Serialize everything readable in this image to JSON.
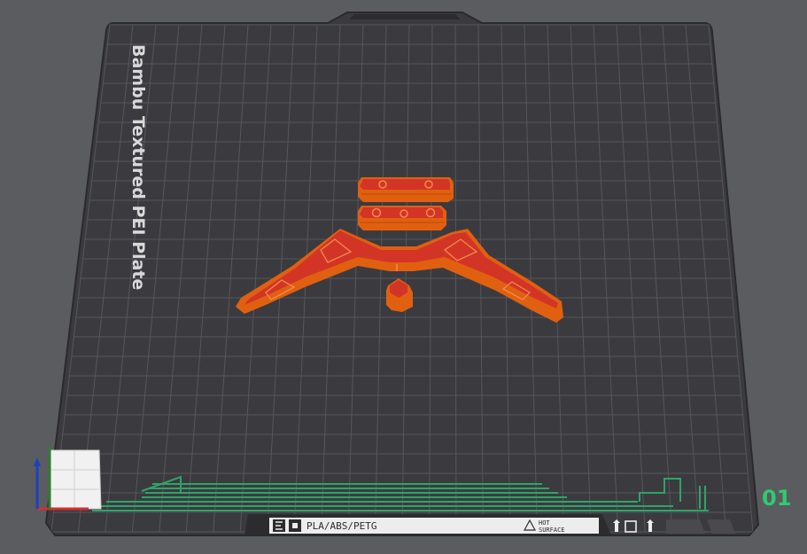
{
  "viewport": {
    "plate_name": "Bambu Textured PEI Plate",
    "plate_number": "01",
    "filament_label": "PLA/ABS/PETG",
    "warning_line1": "HOT",
    "warning_line2": "SURFACE"
  },
  "colors": {
    "background": "#5b5c5f",
    "plate": "#3b3b3f",
    "grid": "#55565a",
    "model_wall": "#e06010",
    "model_top": "#d23526",
    "wipe_tower_lines": "#2fa36a",
    "plate_number": "#2ecc71",
    "axis_x": "#d32f2f",
    "axis_y": "#2e7d32",
    "axis_z": "#1e3fbf"
  },
  "objects": [
    {
      "name": "top-bar-piece"
    },
    {
      "name": "middle-bar-piece"
    },
    {
      "name": "wing-bracket"
    },
    {
      "name": "hex-knob"
    }
  ]
}
